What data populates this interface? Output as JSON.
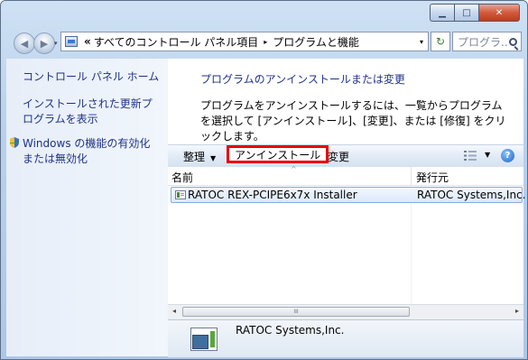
{
  "window": {
    "caption": {
      "minimize": "▁",
      "maximize": "□",
      "close": "✕"
    }
  },
  "navbar": {
    "back_glyph": "◀",
    "forward_glyph": "▶",
    "history_glyph": "▾",
    "address": {
      "overflow": "«",
      "crumbs": [
        "すべてのコントロール パネル項目",
        "プログラムと機能"
      ],
      "separator": "▸",
      "dropdown_glyph": "▾"
    },
    "refresh_glyph": "↻",
    "search_placeholder": "プログラ..."
  },
  "sidebar": {
    "home": "コントロール パネル ホーム",
    "view_updates": "インストールされた更新プログラムを表示",
    "windows_features": "Windows の機能の有効化または無効化"
  },
  "main": {
    "title": "プログラムのアンインストールまたは変更",
    "description": "プログラムをアンインストールするには、一覧からプログラムを選択して [アンインストール]、[変更]、または [修復] をクリックします。"
  },
  "toolbar": {
    "organize": "整理",
    "dropdown_glyph": "▼",
    "uninstall": "アンインストール",
    "change": "変更",
    "help": "?"
  },
  "list": {
    "columns": {
      "name": "名前",
      "publisher": "発行元",
      "sort_glyph": "^"
    },
    "rows": [
      {
        "name": "RATOC REX-PCIPE6x7x Installer",
        "publisher": "RATOC Systems,Inc."
      }
    ]
  },
  "scrollbar": {
    "left_glyph": "◂",
    "thumb_glyph": "III",
    "right_glyph": "▸"
  },
  "details": {
    "publisher": "RATOC Systems,Inc."
  },
  "colors": {
    "link": "#1e3287",
    "highlight_border": "#ea0000",
    "selection": "#dce9fb"
  },
  "icons": {
    "address": "control-panel-icon",
    "search": "search-icon",
    "shield": "uac-shield-icon",
    "views": "views-icon",
    "help": "help-icon",
    "program": "program-icon"
  }
}
